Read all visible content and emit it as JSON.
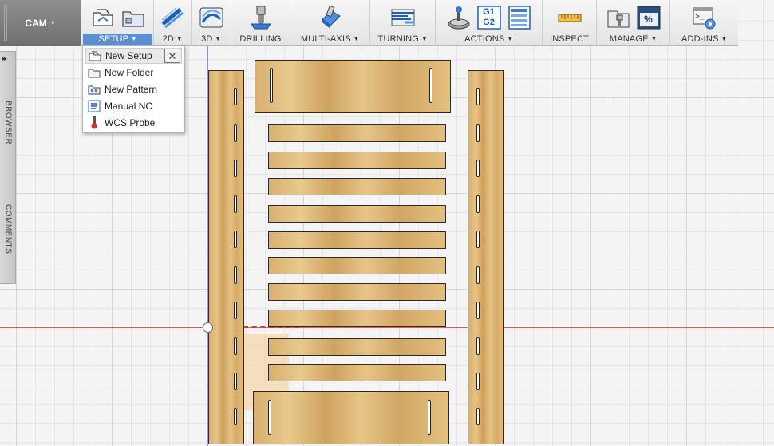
{
  "workspace": {
    "label": "CAM"
  },
  "toolbar": {
    "groups": [
      {
        "id": "setup",
        "label": "SETUP",
        "has_menu": true,
        "active": true
      },
      {
        "id": "2d",
        "label": "2D",
        "has_menu": true
      },
      {
        "id": "3d",
        "label": "3D",
        "has_menu": true
      },
      {
        "id": "drilling",
        "label": "DRILLING",
        "has_menu": false
      },
      {
        "id": "multiaxis",
        "label": "MULTI-AXIS",
        "has_menu": true
      },
      {
        "id": "turning",
        "label": "TURNING",
        "has_menu": true
      },
      {
        "id": "actions",
        "label": "ACTIONS",
        "has_menu": true
      },
      {
        "id": "inspect",
        "label": "INSPECT",
        "has_menu": false
      },
      {
        "id": "manage",
        "label": "MANAGE",
        "has_menu": true
      },
      {
        "id": "addins",
        "label": "ADD-INS",
        "has_menu": true
      }
    ],
    "actions_gcode_top": "G1",
    "actions_gcode_bottom": "G2",
    "manage_percent": "%",
    "addins_prompt": ">_"
  },
  "side_panel": {
    "expand_glyph": "▸▸",
    "tabs": [
      {
        "label": "BROWSER"
      },
      {
        "label": "COMMENTS"
      }
    ]
  },
  "setup_menu": {
    "close_glyph": "✕",
    "items": [
      {
        "label": "New Setup",
        "icon": "new-setup-icon",
        "highlighted": true
      },
      {
        "label": "New Folder",
        "icon": "folder-icon"
      },
      {
        "label": "New Pattern",
        "icon": "pattern-icon"
      },
      {
        "label": "Manual NC",
        "icon": "manual-nc-icon"
      },
      {
        "label": "WCS Probe",
        "icon": "probe-icon"
      }
    ]
  },
  "colors": {
    "accent": "#5d8fd0",
    "axis_red": "#e0605a",
    "axis_blue": "#6b6be0",
    "wood": "#dcb271"
  }
}
